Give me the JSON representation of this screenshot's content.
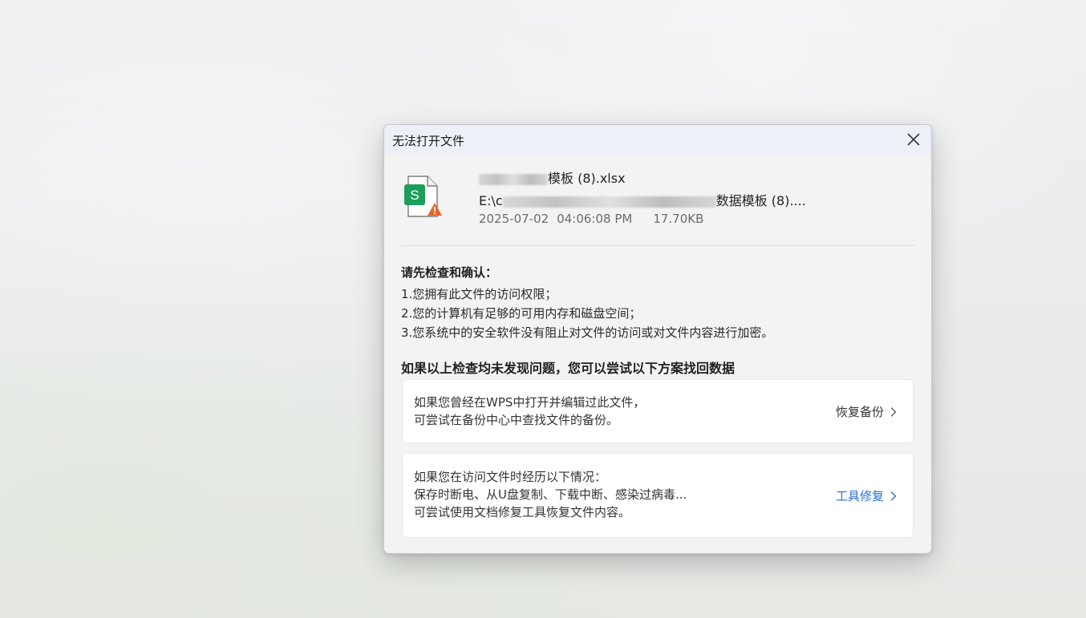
{
  "dialog": {
    "title": "无法打开文件",
    "close_icon": "close-icon"
  },
  "file": {
    "icon": "spreadsheet-file-warning-icon",
    "icon_letter": "S",
    "name_visible": "模板 (8).xlsx",
    "path_prefix": "E:\\c",
    "path_suffix": "数据模板 (8)....",
    "date": "2025-07-02",
    "time": "04:06:08 PM",
    "size": "17.70KB"
  },
  "checks": {
    "heading": "请先检查和确认：",
    "items": [
      "1.您拥有此文件的访问权限；",
      "2.您的计算机有足够的可用内存和磁盘空间；",
      "3.您系统中的安全软件没有阻止对文件的访问或对文件内容进行加密。"
    ]
  },
  "solutions": {
    "heading": "如果以上检查均未发现问题，您可以尝试以下方案找回数据",
    "backup": {
      "lines": [
        "如果您曾经在WPS中打开并编辑过此文件，",
        "可尝试在备份中心中查找文件的备份。"
      ],
      "action": "恢复备份",
      "action_icon": "chevron-right-icon"
    },
    "repair": {
      "lines": [
        "如果您在访问文件时经历以下情况：",
        "保存时断电、从U盘复制、下载中断、感染过病毒...",
        "可尝试使用文档修复工具恢复文件内容。"
      ],
      "action": "工具修复",
      "action_icon": "chevron-right-icon"
    }
  },
  "colors": {
    "link": "#2b6fd6",
    "spreadsheet_green": "#1b9e5a",
    "warning_orange": "#e8632b"
  }
}
